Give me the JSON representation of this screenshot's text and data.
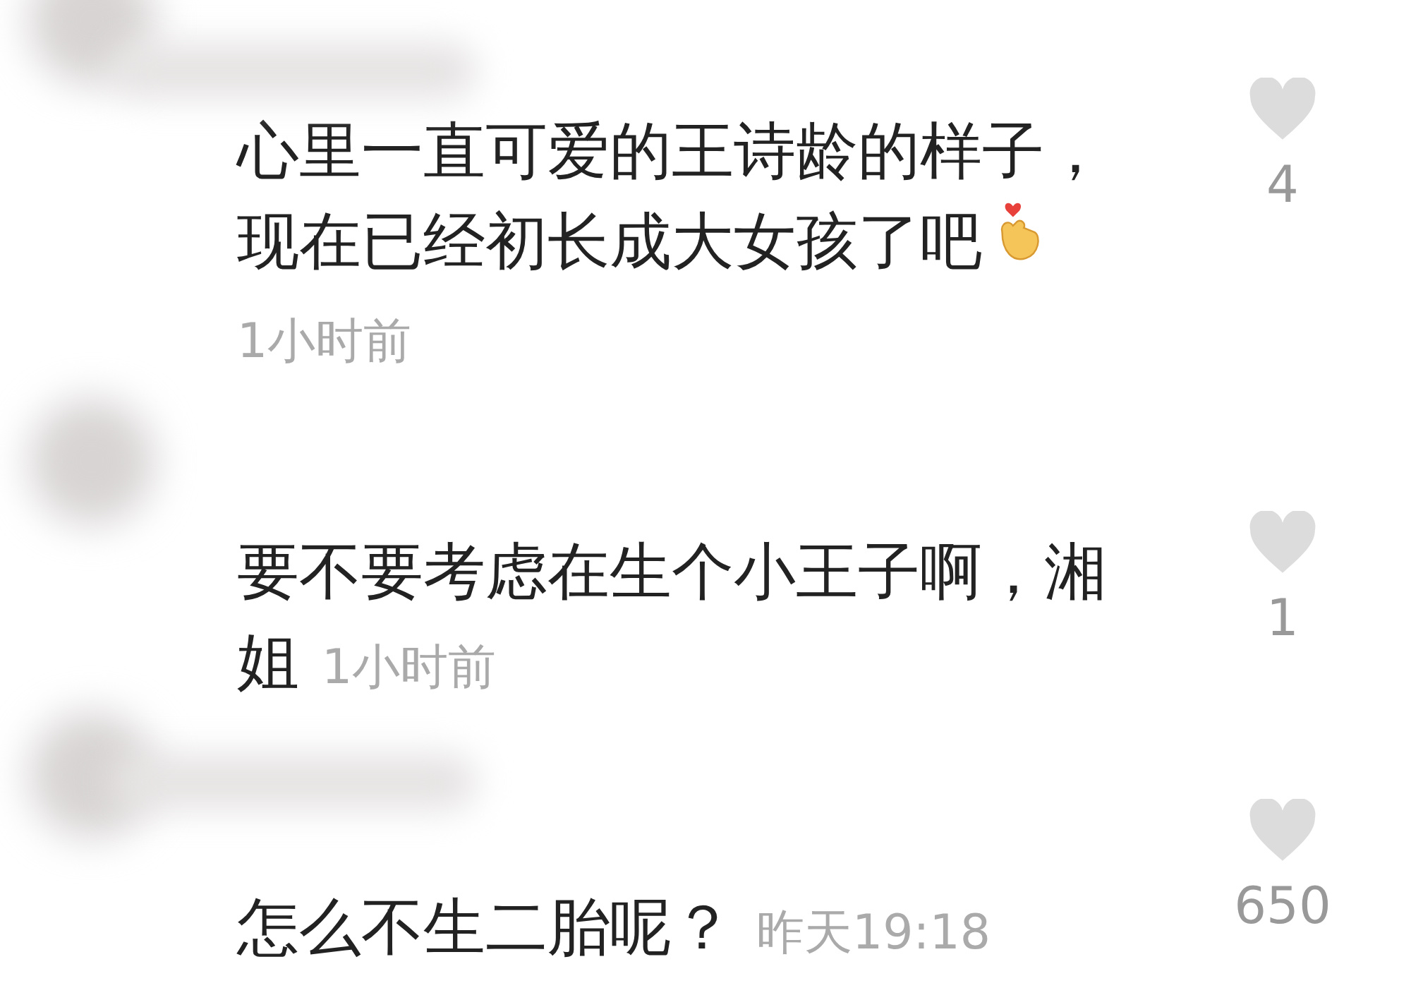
{
  "comments": [
    {
      "lines": [
        "心里一直可爱的王诗龄的样子，",
        "现在已经初长成大女孩了吧"
      ],
      "finger_heart": true,
      "time": "1小时前",
      "time_inline": false,
      "likes": "4"
    },
    {
      "lines": [
        "要不要考虑在生个小王子啊，湘",
        "姐"
      ],
      "finger_heart": false,
      "time": "1小时前",
      "time_inline": true,
      "likes": "1"
    },
    {
      "lines": [
        "怎么不生二胎呢？"
      ],
      "finger_heart": false,
      "time": "昨天19:18",
      "time_inline": true,
      "likes": "650"
    }
  ]
}
